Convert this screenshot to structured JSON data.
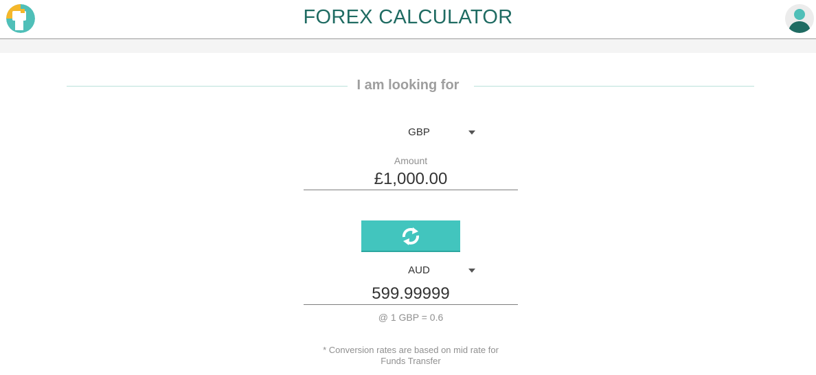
{
  "header": {
    "title": "FOREX CALCULATOR",
    "logo_icon": "forex-logo-icon",
    "avatar_icon": "user-avatar-icon"
  },
  "section": {
    "heading": "I am looking for"
  },
  "from": {
    "currency": "GBP",
    "amount_label": "Amount",
    "amount_value": "£1,000.00"
  },
  "swap": {
    "icon": "swap-arrows-icon"
  },
  "to": {
    "currency": "AUD",
    "amount_value": "599.99999",
    "rate_text": "@ 1 GBP = 0.6"
  },
  "note": {
    "line1": "* Conversion rates are based on mid rate for",
    "line2": "Funds Transfer"
  },
  "colors": {
    "title": "#1f6b62",
    "accent": "#42c5be",
    "divider": "#b9e0da"
  }
}
